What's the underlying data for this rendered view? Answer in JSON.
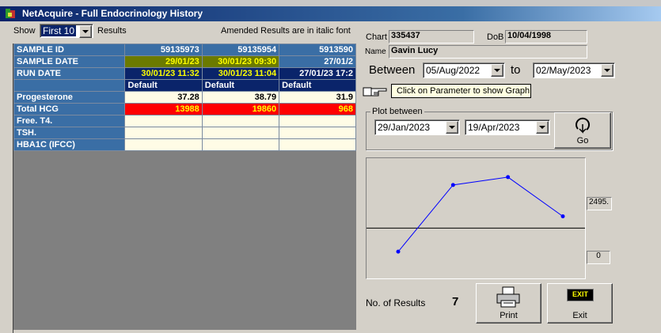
{
  "window": {
    "title": "NetAcquire - Full Endocrinology History"
  },
  "toolbar": {
    "show_label": "Show",
    "show_value": "First 10",
    "results_label": "Results",
    "amended_note": "Amended  Results are in italic font"
  },
  "grid": {
    "row_headers": [
      "SAMPLE ID",
      "SAMPLE DATE",
      "RUN DATE",
      "",
      "Progesterone",
      "Total HCG",
      "Free. T4.",
      "TSH.",
      "HBA1C (IFCC)"
    ],
    "columns": [
      {
        "sample_id": "59135973",
        "sample_date": "29/01/23",
        "run_date": "30/01/23 11:32",
        "profile": "Default",
        "progesterone": "37.28",
        "total_hcg": "13988"
      },
      {
        "sample_id": "59135954",
        "sample_date": "30/01/23 09:30",
        "run_date": "30/01/23 11:04",
        "profile": "Default",
        "progesterone": "38.79",
        "total_hcg": "19860"
      },
      {
        "sample_id": "5913590",
        "sample_date": "27/01/2",
        "run_date": "27/01/23 17:2",
        "profile": "Default",
        "progesterone": "31.9",
        "total_hcg": "968"
      }
    ]
  },
  "patient": {
    "chart_label": "Chart",
    "chart_value": "335437",
    "dob_label": "DoB",
    "dob_value": "10/04/1998",
    "name_label": "Name",
    "name_value": "Gavin Lucy"
  },
  "range": {
    "between_label": "Between",
    "from": "05/Aug/2022",
    "to_label": "to",
    "to": "02/May/2023"
  },
  "hint": "Click on Parameter to show Graph",
  "plot": {
    "group_label": "Plot between",
    "from": "29/Jan/2023",
    "to": "19/Apr/2023",
    "go_label": "Go"
  },
  "chart_data": {
    "type": "line",
    "x": [
      1,
      2,
      3,
      4
    ],
    "values": [
      -0.6,
      1.1,
      1.3,
      0.3
    ],
    "axis_max_label": "2495.",
    "axis_min_label": "0",
    "color": "#0000ff"
  },
  "footer": {
    "count_label": "No. of Results",
    "count_value": "7",
    "print_label": "Print",
    "exit_label": "Exit",
    "exit_badge": "EXIT"
  },
  "colors": {
    "title_start": "#0a246a",
    "highlight_red": "#ff0000",
    "highlight_yellow": "#ffff00"
  }
}
